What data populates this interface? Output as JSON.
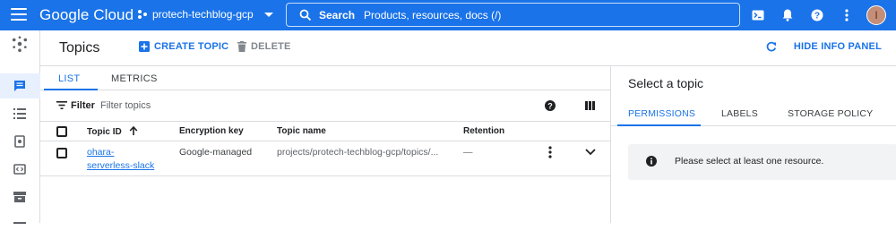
{
  "header": {
    "logo": "Google Cloud",
    "project": "protech-techblog-gcp",
    "search_label": "Search",
    "search_placeholder": "Products, resources, docs (/)",
    "avatar_initial": "I"
  },
  "toolbar": {
    "title": "Topics",
    "create_label": "CREATE TOPIC",
    "delete_label": "DELETE",
    "hide_panel_label": "HIDE INFO PANEL"
  },
  "tabs": {
    "list": "LIST",
    "metrics": "METRICS"
  },
  "filter": {
    "label": "Filter",
    "placeholder": "Filter topics"
  },
  "table": {
    "columns": [
      "Topic ID",
      "Encryption key",
      "Topic name",
      "Retention"
    ],
    "rows": [
      {
        "topic_id_line1": "ohara-",
        "topic_id_line2": "serverless-slack",
        "encryption": "Google-managed",
        "topic_name": "projects/protech-techblog-gcp/topics/...",
        "retention": "—"
      }
    ]
  },
  "info_panel": {
    "title": "Select a topic",
    "tabs": [
      "PERMISSIONS",
      "LABELS",
      "STORAGE POLICY"
    ],
    "notice": "Please select at least one resource."
  },
  "colors": {
    "primary": "#1a73e8",
    "border": "#dadce0",
    "notice_bg": "#f1f3f4"
  }
}
